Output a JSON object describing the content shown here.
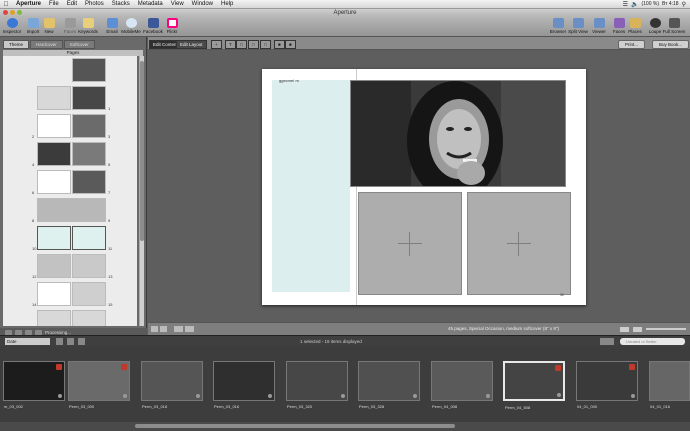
{
  "menubar": {
    "items": [
      "Aperture",
      "File",
      "Edit",
      "Photos",
      "Stacks",
      "Metadata",
      "View",
      "Window",
      "Help"
    ],
    "battery": "(100 %)",
    "clock": "Вт 4:18"
  },
  "window": {
    "title": "Aperture"
  },
  "toolbar": {
    "left": [
      "Inspector",
      "Import",
      "New",
      "Faces",
      "Keywords",
      "Email",
      "MobileMe",
      "Facebook",
      "Flickr"
    ],
    "right": [
      "Browser",
      "Split View",
      "Viewer",
      "Faces",
      "Places",
      "Loupe",
      "Full Screen"
    ]
  },
  "sidebar": {
    "tabs": [
      "Theme",
      "Hardcover",
      "Softcover"
    ],
    "pages_header": "Pages",
    "page_numbers": [
      "1",
      "2",
      "3",
      "4",
      "5",
      "6",
      "7",
      "8",
      "9",
      "10",
      "11",
      "12",
      "13",
      "14",
      "15"
    ],
    "status": "Processing..."
  },
  "main": {
    "edit_tabs": [
      "Edit Content",
      "Edit Layout"
    ],
    "print_button": "Print...",
    "buy_button": "Buy Book...",
    "caption_text": "ggecme! m",
    "page_info": "45 pages, Special Occasion, medium softcover (8\" x 8\")",
    "page_corner": "11"
  },
  "browser": {
    "sort": "Date",
    "status": "1 selected - 19 items displayed",
    "search_placeholder": "Unrated or Better"
  },
  "filmstrip": {
    "items": [
      {
        "label": "m_03_002",
        "badge": true
      },
      {
        "label": "Perm_03_000",
        "badge": true
      },
      {
        "label": "Perm_03_018",
        "badge": false
      },
      {
        "label": "Perm_03_016",
        "badge": false
      },
      {
        "label": "Perm_03_320",
        "badge": false
      },
      {
        "label": "Perm_03_328",
        "badge": false
      },
      {
        "label": "Perm_04_008",
        "badge": false
      },
      {
        "label": "Perm_04_508",
        "badge": true
      },
      {
        "label": "04_01_000",
        "badge": true
      },
      {
        "label": "04_01_016",
        "badge": false
      }
    ]
  }
}
